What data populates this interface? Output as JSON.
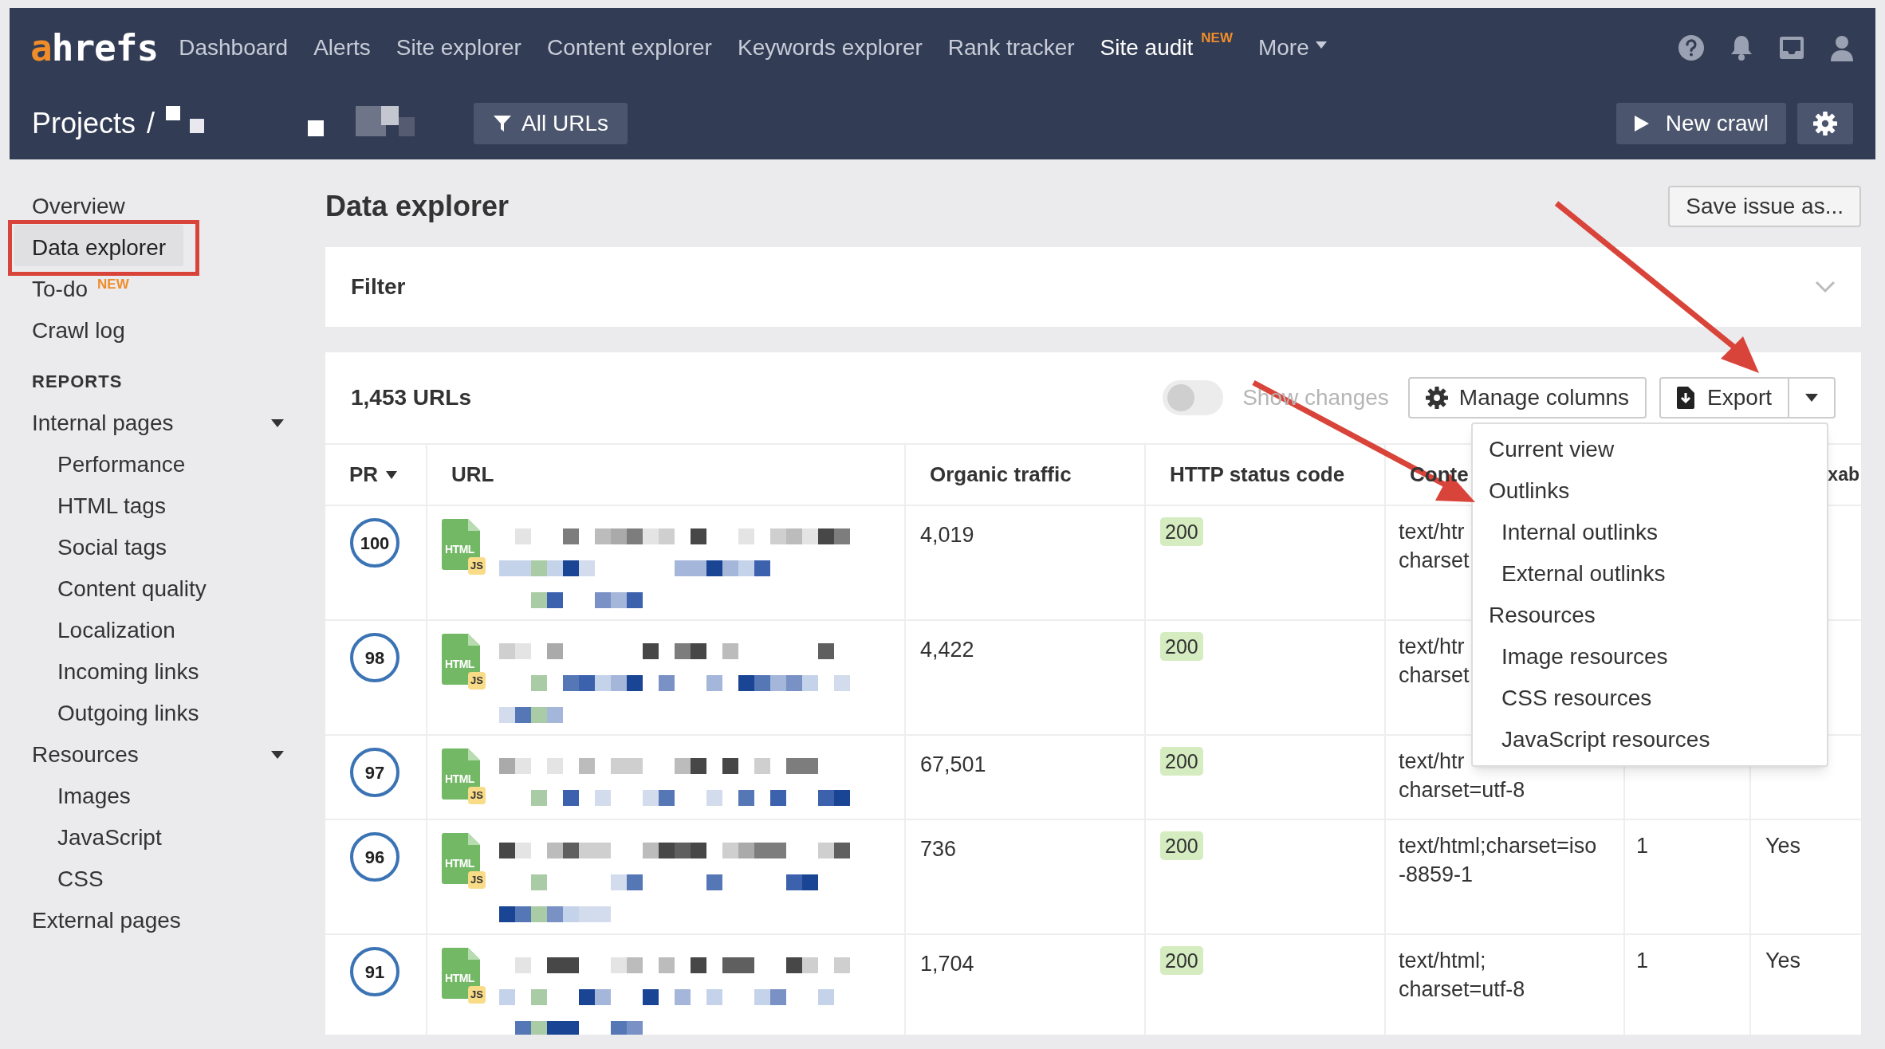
{
  "logo": {
    "accent": "a",
    "rest": "hrefs"
  },
  "nav": [
    {
      "label": "Dashboard",
      "selected": false
    },
    {
      "label": "Alerts",
      "selected": false
    },
    {
      "label": "Site explorer",
      "selected": false
    },
    {
      "label": "Content explorer",
      "selected": false
    },
    {
      "label": "Keywords explorer",
      "selected": false
    },
    {
      "label": "Rank tracker",
      "selected": false
    },
    {
      "label": "Site audit",
      "selected": true,
      "badge": "NEW"
    },
    {
      "label": "More",
      "selected": false,
      "kind": "dropdown"
    }
  ],
  "breadcrumb": {
    "root": "Projects",
    "separator": "/"
  },
  "filter_button": "All URLs",
  "new_crawl_button": "New crawl",
  "sidebar": {
    "items": [
      {
        "label": "Overview",
        "selected": false
      },
      {
        "label": "Data explorer",
        "selected": true
      },
      {
        "label": "To-do",
        "selected": false,
        "badge": "NEW"
      },
      {
        "label": "Crawl log",
        "selected": false
      }
    ],
    "section": "REPORTS",
    "reports": [
      {
        "label": "Internal pages",
        "expanded": true,
        "children": [
          {
            "label": "Performance"
          },
          {
            "label": "HTML tags"
          },
          {
            "label": "Social tags"
          },
          {
            "label": "Content quality"
          },
          {
            "label": "Localization"
          },
          {
            "label": "Incoming links"
          },
          {
            "label": "Outgoing links"
          }
        ]
      },
      {
        "label": "Resources",
        "expanded": true,
        "children": [
          {
            "label": "Images"
          },
          {
            "label": "JavaScript"
          },
          {
            "label": "CSS"
          }
        ]
      },
      {
        "label": "External pages"
      }
    ]
  },
  "page_title": "Data explorer",
  "save_button": "Save issue as...",
  "filter_panel": {
    "label": "Filter",
    "expanded": false
  },
  "table_toolbar": {
    "count": "1,453 URLs",
    "show_changes": {
      "label": "Show changes",
      "on": false
    },
    "manage_columns": "Manage columns",
    "export": "Export"
  },
  "export_menu": [
    {
      "label": "Current view"
    },
    {
      "label": "Outlinks",
      "children": [
        {
          "label": "Internal outlinks"
        },
        {
          "label": "External outlinks"
        }
      ]
    },
    {
      "label": "Resources",
      "children": [
        {
          "label": "Image resources"
        },
        {
          "label": "CSS resources"
        },
        {
          "label": "JavaScript resources"
        }
      ]
    }
  ],
  "table": {
    "columns": [
      {
        "label": "PR",
        "sorted": true
      },
      {
        "label": "URL"
      },
      {
        "label": "Organic traffic"
      },
      {
        "label": "HTTP status code"
      },
      {
        "label": "Conte"
      },
      {},
      {
        "label": "xab"
      }
    ],
    "rows": [
      {
        "pr": {
          "value": "100"
        },
        "file": {
          "label": "HTML",
          "badge": "JS"
        },
        "organic_traffic": "4,019",
        "status": "200",
        "content_type": [
          "text/htr",
          "charset"
        ]
      },
      {
        "pr": {
          "value": "98"
        },
        "file": {
          "label": "HTML",
          "badge": "JS"
        },
        "organic_traffic": "4,422",
        "status": "200",
        "content_type": [
          "text/htr",
          "charset"
        ]
      },
      {
        "pr": {
          "value": "97"
        },
        "file": {
          "label": "HTML",
          "badge": "JS"
        },
        "organic_traffic": "67,501",
        "status": "200",
        "content_type": [
          "text/htr",
          "charset=utf-8"
        ]
      },
      {
        "pr": {
          "value": "96"
        },
        "file": {
          "label": "HTML",
          "badge": "JS"
        },
        "organic_traffic": "736",
        "status": "200",
        "content_type": [
          "text/html;charset=iso",
          "-8859-1"
        ],
        "column_6": "1",
        "column_7": "Yes"
      },
      {
        "pr": {
          "value": "91"
        },
        "file": {
          "label": "HTML",
          "badge": "JS"
        },
        "organic_traffic": "1,704",
        "status": "200",
        "content_type": [
          "text/html;",
          "charset=utf-8"
        ],
        "column_6": "1",
        "column_7": "Yes"
      }
    ]
  }
}
